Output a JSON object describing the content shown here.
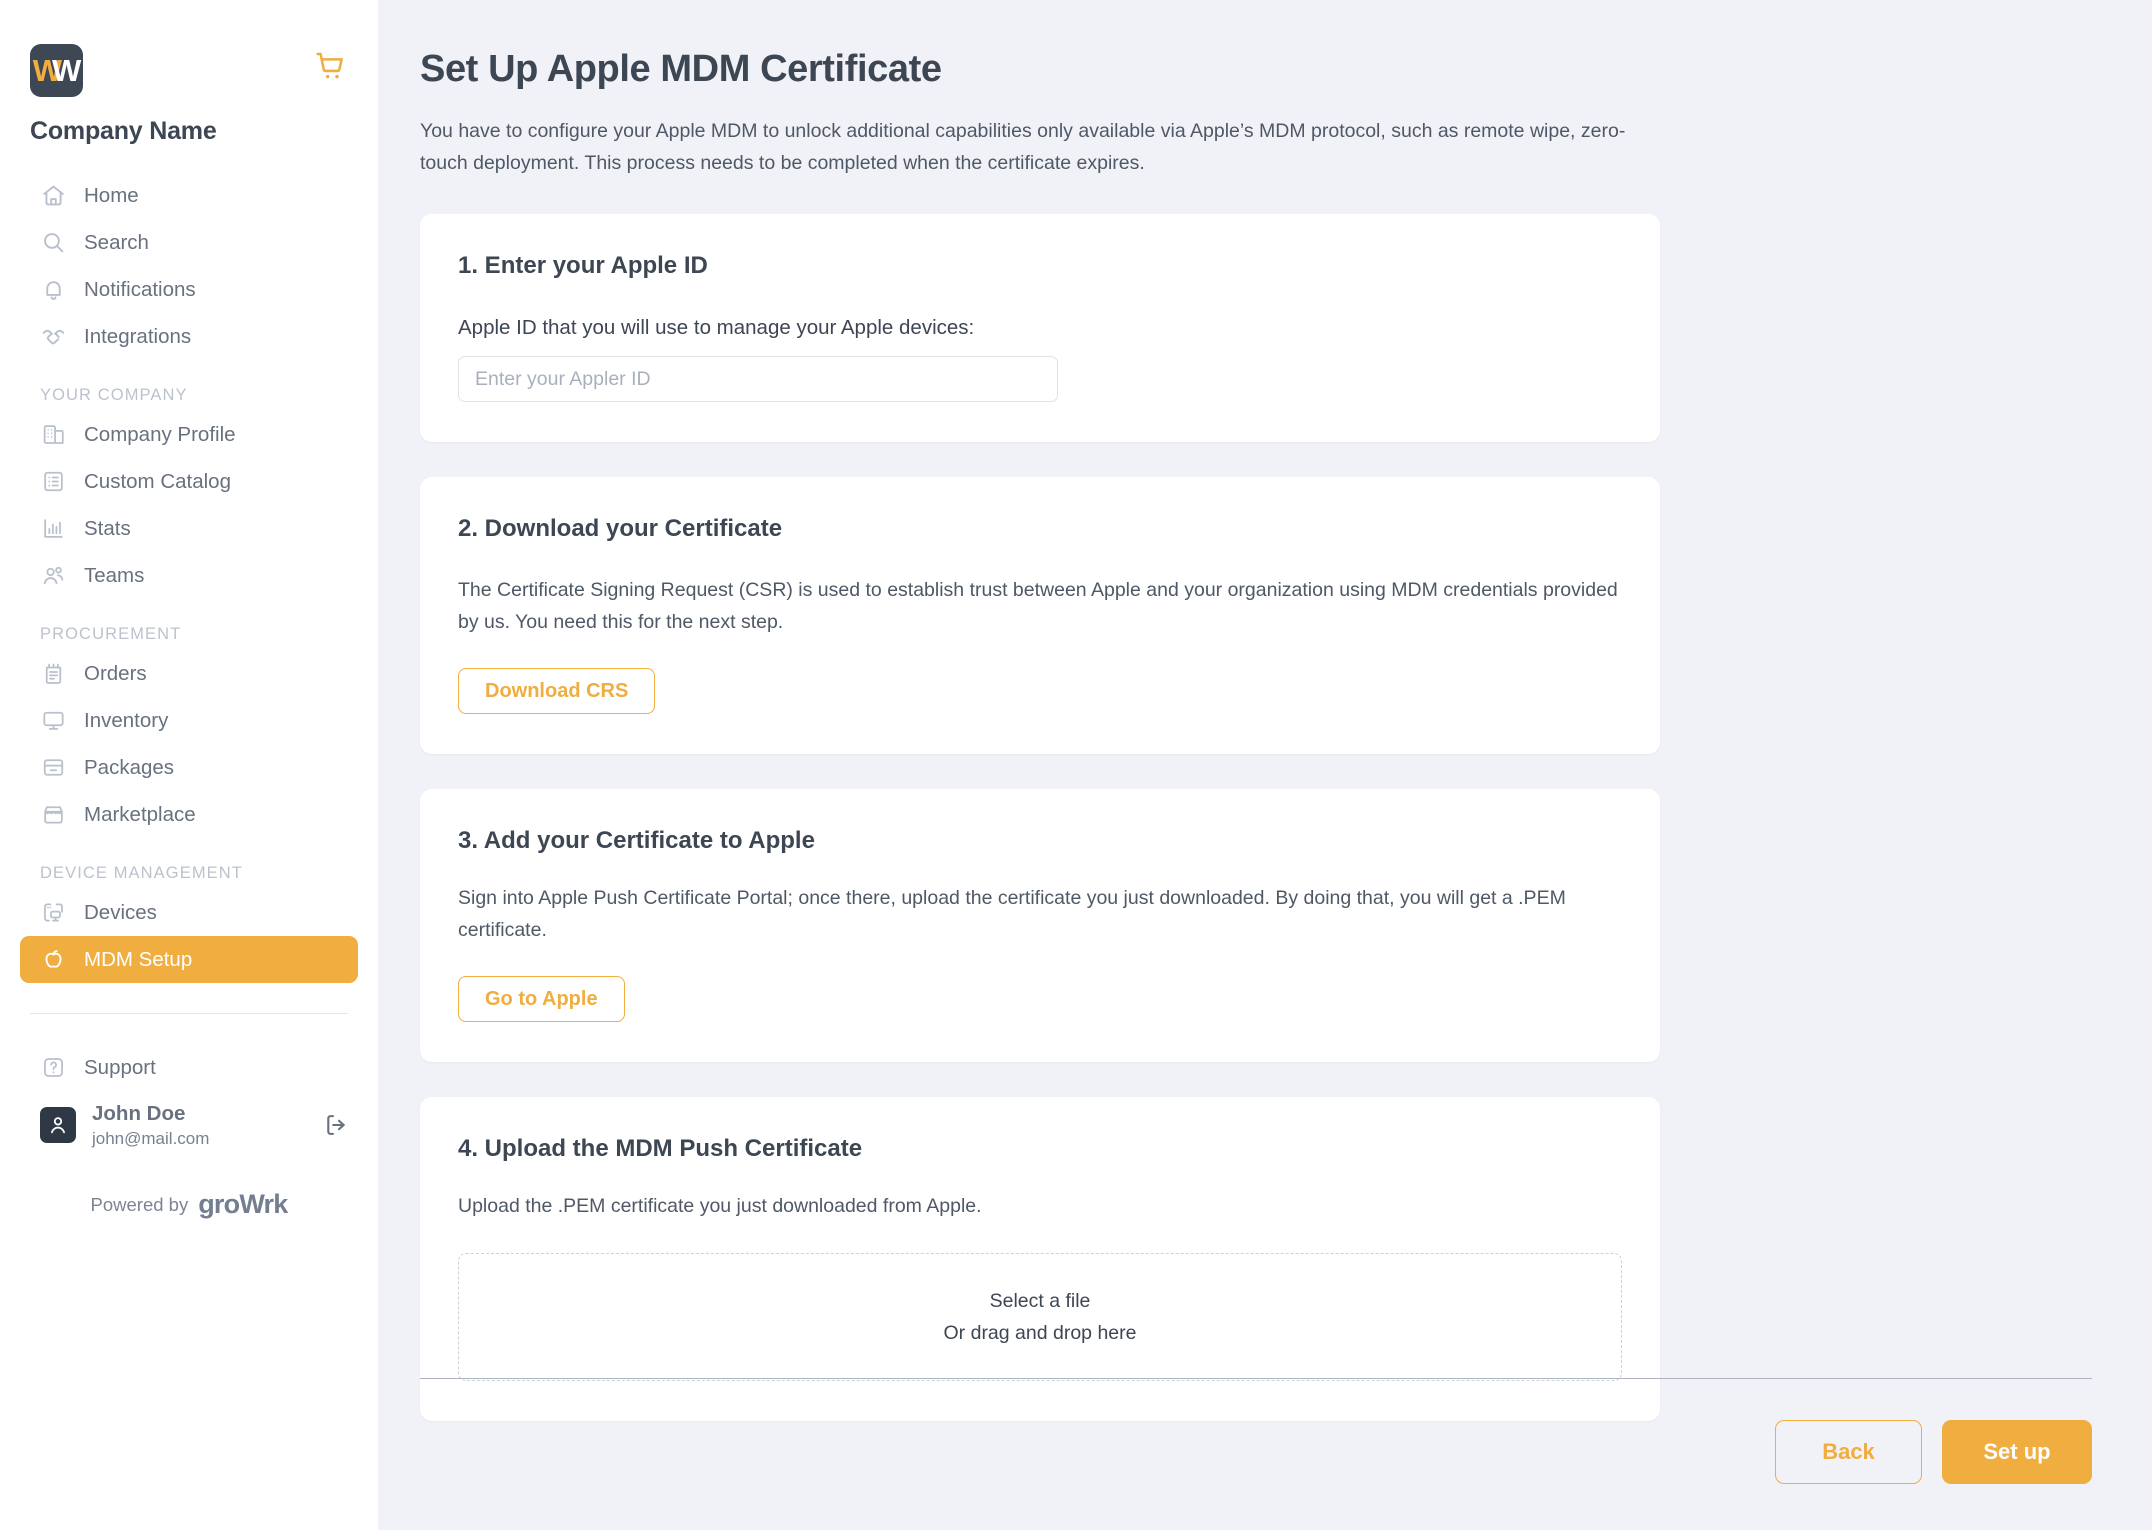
{
  "theme": {
    "accent": "#f0ad40",
    "page_bg": "#f1f2f7",
    "card_bg": "#ffffff",
    "text_dark": "#3d4653",
    "text_muted": "#69717f",
    "logo_bg": "#3e4855"
  },
  "sidebar": {
    "logo_letter_left": "W",
    "logo_letter_right": "W",
    "cart_icon": "shopping-cart-icon",
    "company_name": "Company Name",
    "nav_primary": [
      {
        "label": "Home",
        "icon": "home-icon"
      },
      {
        "label": "Search",
        "icon": "search-icon"
      },
      {
        "label": "Notifications",
        "icon": "bell-icon"
      },
      {
        "label": "Integrations",
        "icon": "handshake-icon"
      }
    ],
    "section_company": {
      "title": "YOUR COMPANY",
      "items": [
        {
          "label": "Company Profile",
          "icon": "building-icon"
        },
        {
          "label": "Custom Catalog",
          "icon": "list-card-icon"
        },
        {
          "label": "Stats",
          "icon": "bar-chart-icon"
        },
        {
          "label": "Teams",
          "icon": "users-icon"
        }
      ]
    },
    "section_procurement": {
      "title": "PROCUREMENT",
      "items": [
        {
          "label": "Orders",
          "icon": "notepad-icon"
        },
        {
          "label": "Inventory",
          "icon": "monitor-icon"
        },
        {
          "label": "Packages",
          "icon": "box-icon"
        },
        {
          "label": "Marketplace",
          "icon": "storefront-icon"
        }
      ]
    },
    "section_device": {
      "title": "DEVICE MANAGEMENT",
      "items": [
        {
          "label": "Devices",
          "icon": "device-icon",
          "active": false
        },
        {
          "label": "MDM Setup",
          "icon": "apple-icon",
          "active": true
        }
      ]
    },
    "support": {
      "label": "Support",
      "icon": "question-icon"
    },
    "user": {
      "name": "John Doe",
      "email": "john@mail.com",
      "avatar_icon": "user-avatar-icon",
      "logout_icon": "logout-icon"
    },
    "powered": {
      "prefix": "Powered by",
      "brand": "groWrk"
    }
  },
  "main": {
    "title": "Set Up Apple MDM Certificate",
    "subtitle": "You have to configure your Apple MDM to unlock additional capabilities only available via Apple’s MDM protocol, such as remote wipe, zero-touch deployment. This process needs to be completed when the certificate expires.",
    "steps": {
      "step1": {
        "title": "1. Enter your Apple ID",
        "label": "Apple ID that you will use to manage your Apple devices:",
        "input_placeholder": "Enter your Appler ID",
        "input_value": ""
      },
      "step2": {
        "title": "2. Download your Certificate",
        "text": "The Certificate Signing Request (CSR) is used to establish trust between Apple and your organization using MDM credentials provided by us. You need this for the next step.",
        "button": "Download CRS"
      },
      "step3": {
        "title": "3. Add your Certificate to Apple",
        "text": "Sign into Apple Push Certificate Portal; once there, upload the certificate you just downloaded. By doing that, you will get a .PEM certificate.",
        "button": "Go to Apple"
      },
      "step4": {
        "title": "4. Upload the MDM Push Certificate",
        "text": "Upload the .PEM certificate you just downloaded from Apple.",
        "dropzone_line1": "Select a file",
        "dropzone_line2": "Or drag and drop here"
      }
    },
    "footer": {
      "back": "Back",
      "submit": "Set up"
    }
  }
}
